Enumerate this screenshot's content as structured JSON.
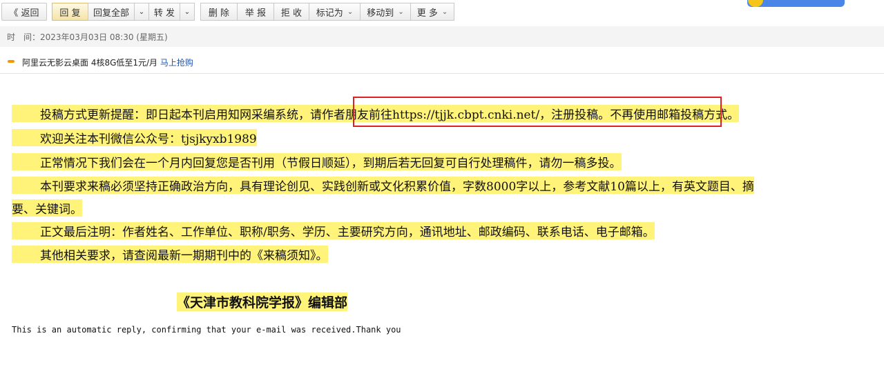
{
  "toolbar": {
    "back": "《 返回",
    "reply": "回 复",
    "reply_all": "回复全部",
    "forward": "转 发",
    "delete": "删 除",
    "report": "举 报",
    "reject": "拒 收",
    "mark_as": "标记为",
    "move_to": "移动到",
    "more": "更 多"
  },
  "meta": {
    "time_label": "时　间：",
    "time_value": "2023年03月03日 08:30 (星期五)"
  },
  "ad": {
    "text": "阿里云无影云桌面 4核8G低至1元/月",
    "link": "马上抢购"
  },
  "content": {
    "p1a": "投稿方式更新提醒：即日起本刊启用知网采编系统，",
    "p1b": "请作者朋友前往https://tjjk.cbpt.cnki.net/，注册投稿。",
    "p1c": "不再使用邮箱投稿方式。",
    "p2": "欢迎关注本刊微信公众号：tjsjkyxb1989",
    "p3": "正常情况下我们会在一个月内回复您是否刊用（节假日顺延），到期后若无回复可自行处理稿件，请勿一稿多投。",
    "p4a": "本刊要求来稿必须坚持正确政治方向，具有理论创见、实践创新或文化积累价值，字数8000字以上，参考文献10篇以上，有英文题目、摘",
    "p4b": "要、关键词。",
    "p5": "正文最后注明：作者姓名、工作单位、职称/职务、学历、主要研究方向，通讯地址、邮政编码、联系电话、电子邮箱。",
    "p6": "其他相关要求，请查阅最新一期期刊中的《来稿须知》。",
    "signature": "《天津市教科院学报》编辑部",
    "auto_reply": "This is an automatic reply, confirming that your e-mail was received.Thank you"
  },
  "colors": {
    "highlight": "#fff37a",
    "annotation_box": "#e02020",
    "link": "#2255aa"
  }
}
